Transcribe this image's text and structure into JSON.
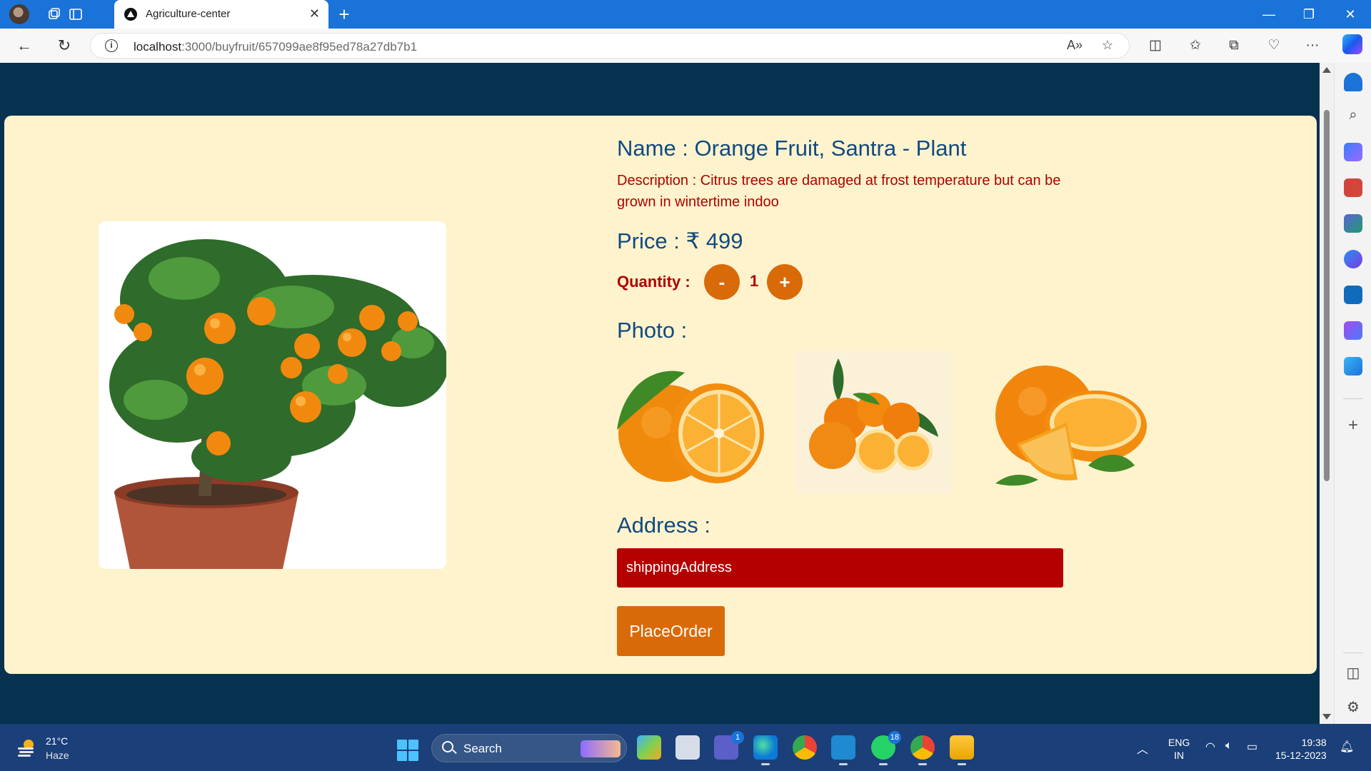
{
  "browser": {
    "tab_title": "Agriculture-center",
    "url_host": "localhost",
    "url_path": ":3000/buyfruit/657099ae8f95ed78a27db7b1"
  },
  "product": {
    "name": "Name : Orange Fruit, Santra - Plant",
    "description": "Description : Citrus trees are damaged at frost temperature but can be grown in wintertime indoo",
    "price": "Price : ₹ 499",
    "quantity_label": "Quantity :",
    "quantity_value": "1",
    "minus_label": "-",
    "plus_label": "+",
    "photo_label": "Photo :",
    "address_label": "Address :",
    "address_value": "shippingAddress",
    "order_button": "PlaceOrder"
  },
  "taskbar": {
    "temperature": "21°C",
    "condition": "Haze",
    "search_label": "Search",
    "teams_badge": "1",
    "whatsapp_badge": "18",
    "lang_line1": "ENG",
    "lang_line2": "IN",
    "time": "19:38",
    "date": "15-12-2023"
  },
  "colors": {
    "page_bg": "#06324f",
    "card_bg": "#fff3cd",
    "heading": "#114a80",
    "accent_red": "#b00000",
    "button_orange": "#d96a08"
  }
}
